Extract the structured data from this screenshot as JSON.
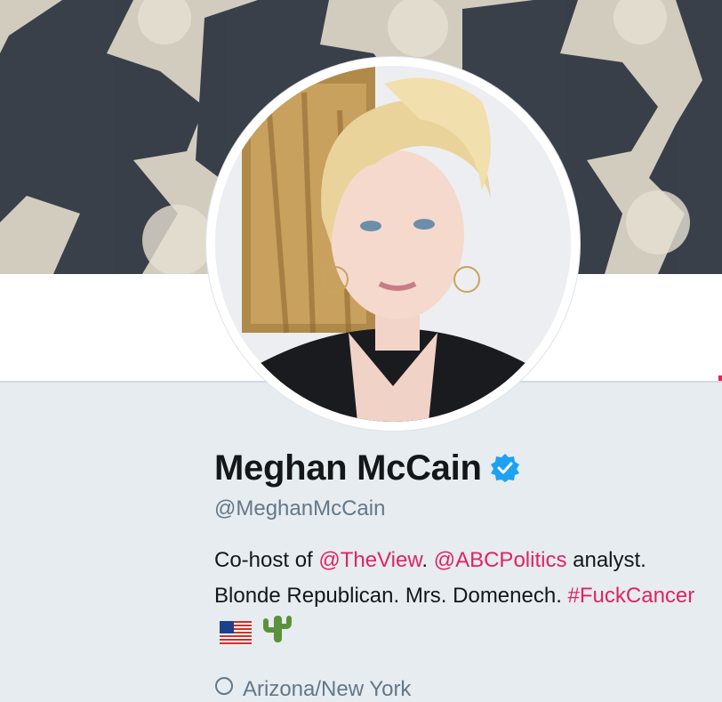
{
  "profile": {
    "name": "Meghan McCain",
    "handle": "@MeghanMcCain",
    "verified_icon": "verified-badge-icon",
    "bio": {
      "part1": "Co-host of ",
      "link1": "@TheView",
      "part2": ". ",
      "link2": "@ABCPolitics",
      "part3": " analyst. Blonde Republican. Mrs. Domenech. ",
      "hashtag": "#FuckCancer",
      "emoji1": "us-flag-emoji",
      "emoji2": "cactus-emoji"
    },
    "location": "Arizona/New York"
  },
  "colors": {
    "link": "#e0245e",
    "verified": "#1da1f2",
    "text": "#14171a",
    "muted": "#657786",
    "background": "#e6ecf0"
  }
}
